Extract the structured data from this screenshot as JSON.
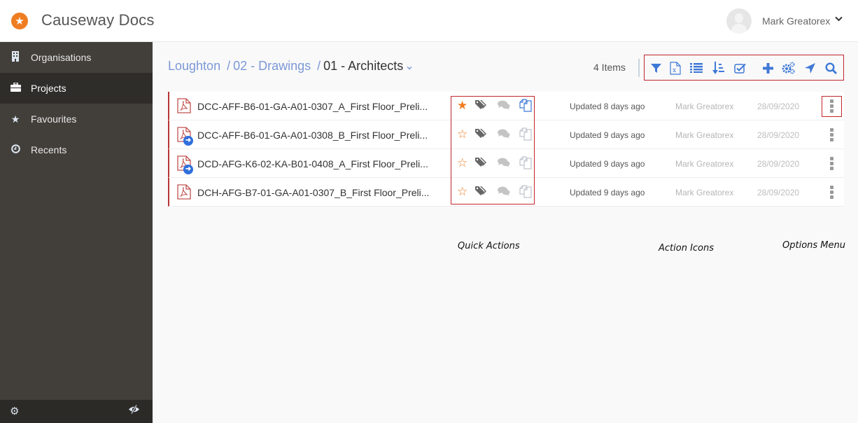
{
  "app": {
    "title": "Causeway Docs",
    "logo_icon": "causeway-star-icon",
    "brand_color": "#ef7d22"
  },
  "user": {
    "name": "Mark Greatorex",
    "menu_icon": "chevron-down-icon"
  },
  "sidebar": {
    "items": [
      {
        "label": "Organisations",
        "icon": "building-icon",
        "active": false
      },
      {
        "label": "Projects",
        "icon": "briefcase-icon",
        "active": true
      },
      {
        "label": "Favourites",
        "icon": "star-icon",
        "active": false
      },
      {
        "label": "Recents",
        "icon": "clock-icon",
        "active": false
      }
    ],
    "footer": {
      "settings_icon": "gear-icon",
      "toggle_icon": "eye-slash-icon"
    }
  },
  "breadcrumb": {
    "items": [
      "Loughton",
      "02 - Drawings"
    ],
    "separator": "/",
    "current": "01 - Architects"
  },
  "header": {
    "item_count": "4 Items"
  },
  "toolbar": {
    "icons": [
      "filter-icon",
      "excel-export-icon",
      "list-view-icon",
      "sort-icon",
      "select-checkbox-icon",
      "add-icon",
      "settings-cogs-icon",
      "navigate-icon",
      "search-icon"
    ],
    "accent_color": "#3f79d6"
  },
  "files": [
    {
      "name": "DCC-AFF-B6-01-GA-A01-0307_A_First Floor_Preli...",
      "favourite": true,
      "linked": false,
      "updated": "Updated 8 days ago",
      "owner": "Mark Greatorex",
      "date": "28/09/2020",
      "copy_active": true
    },
    {
      "name": "DCC-AFF-B6-01-GA-A01-0308_B_First Floor_Preli...",
      "favourite": false,
      "linked": true,
      "updated": "Updated 9 days ago",
      "owner": "Mark Greatorex",
      "date": "28/09/2020",
      "copy_active": false
    },
    {
      "name": "DCD-AFG-K6-02-KA-B01-0408_A_First Floor_Preli...",
      "favourite": false,
      "linked": true,
      "updated": "Updated 9 days ago",
      "owner": "Mark Greatorex",
      "date": "28/09/2020",
      "copy_active": false
    },
    {
      "name": "DCH-AFG-B7-01-GA-A01-0307_B_First Floor_Preli...",
      "favourite": false,
      "linked": false,
      "updated": "Updated 9 days ago",
      "owner": "Mark Greatorex",
      "date": "28/09/2020",
      "copy_active": false
    }
  ],
  "annotations": {
    "quick_actions": "Quick Actions",
    "action_icons": "Action Icons",
    "options_menu": "Options Menu"
  }
}
